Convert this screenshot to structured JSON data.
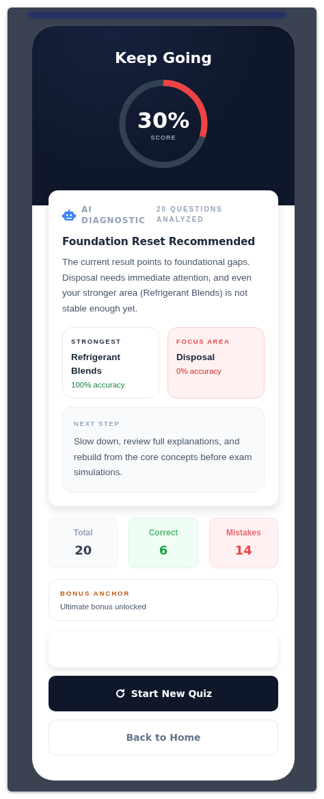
{
  "result": {
    "title": "Keep Going",
    "score": "30%",
    "score_label": "SCORE",
    "level": 0.3
  },
  "diagnostic": {
    "badge": "AI DIAGNOSTIC",
    "meta": "20 QUESTIONS ANALYZED",
    "heading": "Foundation Reset Recommended",
    "summary": "The current result points to foundational gaps. Disposal needs immediate attention, and even your stronger area (Refrigerant Blends) is not stable enough yet.",
    "areas": [
      {
        "kind": "strongest",
        "label": "STRONGEST",
        "topic": "Refrigerant Blends",
        "accuracy": "100% accuracy"
      },
      {
        "kind": "focus",
        "label": "FOCUS AREA",
        "topic": "Disposal",
        "accuracy": "0% accuracy"
      }
    ],
    "next_step": {
      "label": "NEXT STEP",
      "text": "Slow down, review full explanations, and rebuild from the core concepts before exam simulations."
    }
  },
  "stats": [
    {
      "kind": "total",
      "label": "Total",
      "value": "20"
    },
    {
      "kind": "correct",
      "label": "Correct",
      "value": "6"
    },
    {
      "kind": "mistakes",
      "label": "Mistakes",
      "value": "14"
    }
  ],
  "bonus": {
    "label": "BONUS ANCHOR",
    "text": "Ultimate bonus unlocked"
  },
  "buttons": [
    {
      "kind": "primary",
      "label": "Start New Quiz"
    },
    {
      "kind": "secondary",
      "label": "Back to Home"
    }
  ]
}
